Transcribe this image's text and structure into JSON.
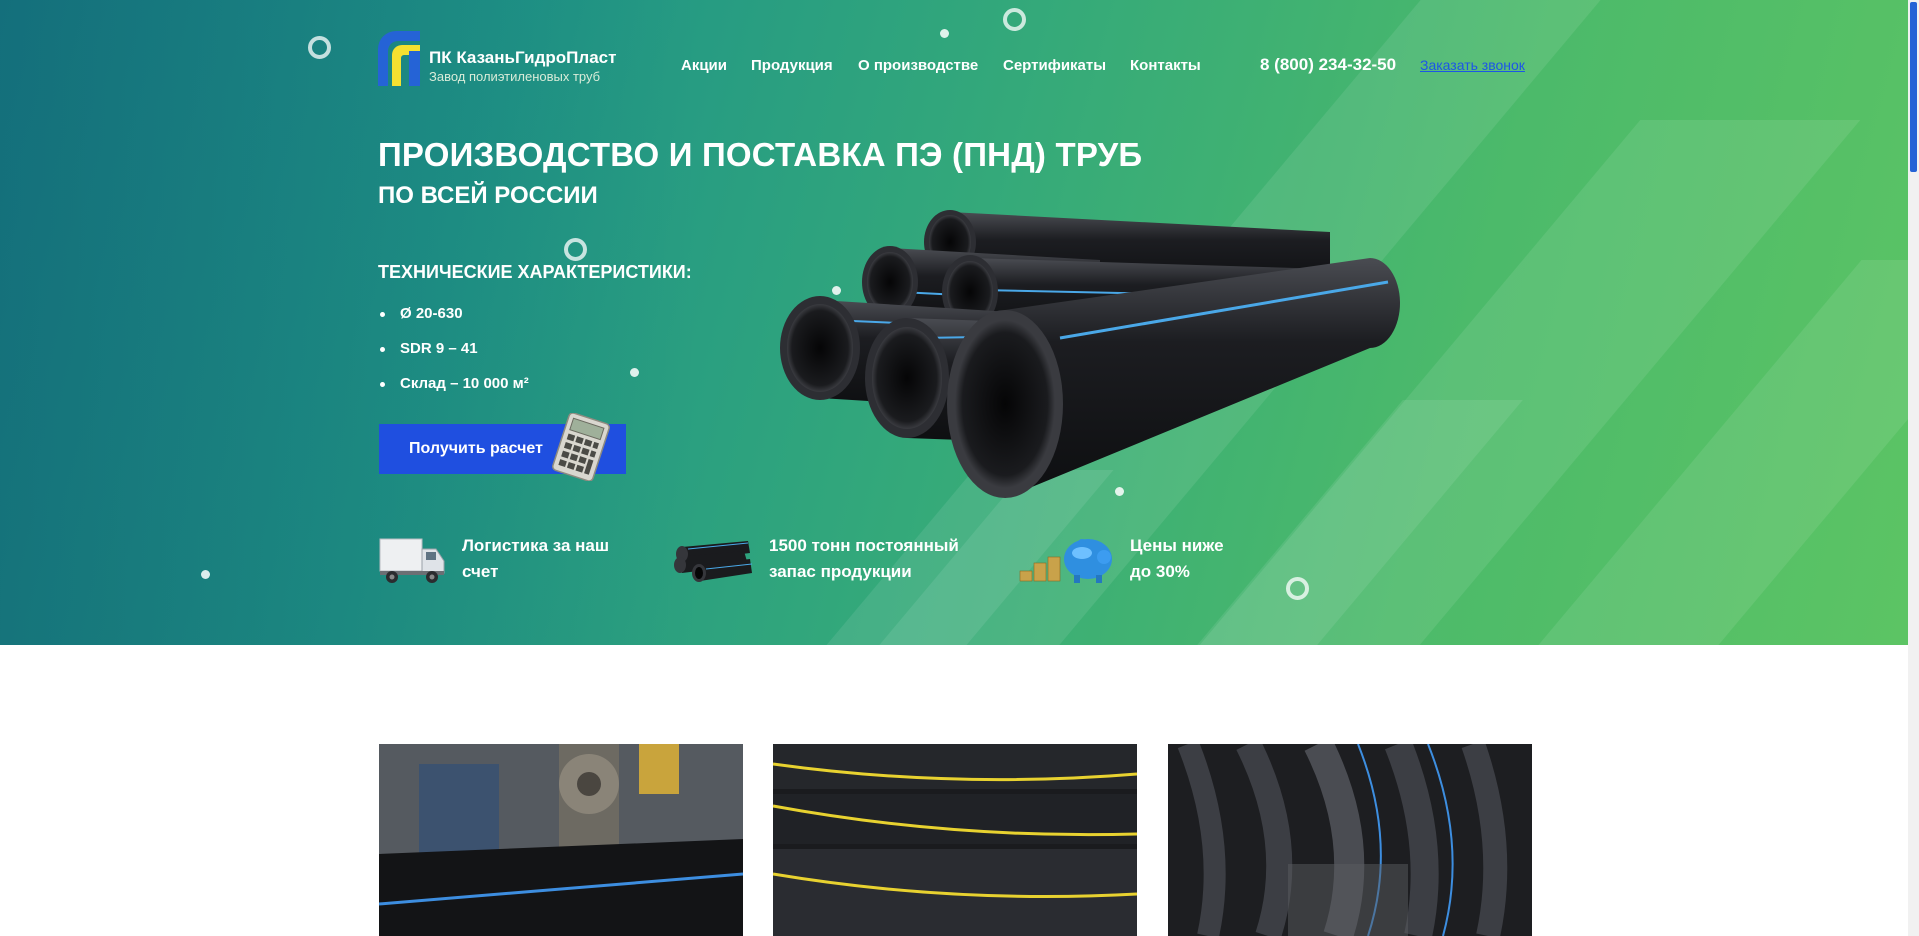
{
  "brand": {
    "name": "ПК КазаньГидроПласт",
    "tagline": "Завод полиэтиленовых труб",
    "logo_colors": [
      "#2563d6",
      "#f5e030"
    ]
  },
  "nav": {
    "items": [
      "Акции",
      "Продукция",
      "О производстве",
      "Сертификаты",
      "Контакты"
    ]
  },
  "contact": {
    "phone": "8 (800) 234-32-50",
    "callback_label": "Заказать звонок"
  },
  "hero": {
    "title": "ПРОИЗВОДСТВО И ПОСТАВКА ПЭ (ПНД) ТРУБ",
    "subtitle": "ПО ВСЕЙ РОССИИ",
    "specs_title": "ТЕХНИЧЕСКИЕ ХАРАКТЕРИСТИКИ:",
    "specs": [
      "Ø 20-630",
      "SDR 9 – 41",
      "Склад – 10 000 м²"
    ],
    "cta_label": "Получить расчет"
  },
  "features": [
    {
      "icon": "truck-icon",
      "text_line1": "Логистика за наш",
      "text_line2": "счет"
    },
    {
      "icon": "pipes-icon",
      "text_line1": "1500 тонн постоянный",
      "text_line2": "запас продукции"
    },
    {
      "icon": "piggy-bank-icon",
      "text_line1": "Цены ниже",
      "text_line2": "до 30%"
    }
  ],
  "gallery": {
    "items": [
      "pipe-machine-photo",
      "pipe-yellow-stripe-photo",
      "pipe-coils-photo"
    ]
  },
  "colors": {
    "accent": "#1f4fe0",
    "link": "#1d56e6",
    "hero_start": "#17808a",
    "hero_end": "#5cc464"
  }
}
